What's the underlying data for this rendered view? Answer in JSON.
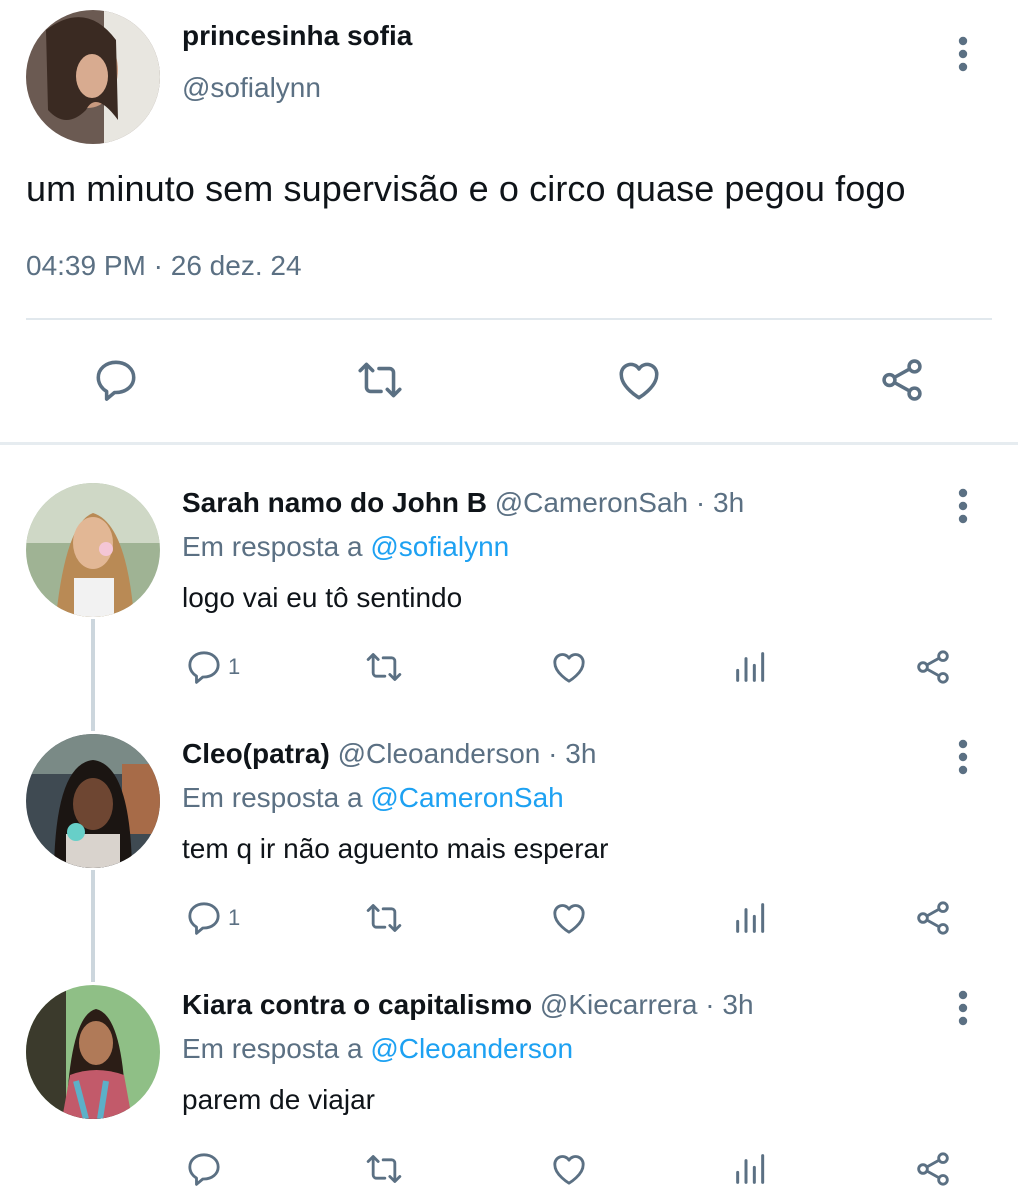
{
  "main_tweet": {
    "display_name": "princesinha sofia",
    "handle": "@sofialynn",
    "text": "um minuto sem supervisão e o circo quase pegou fogo",
    "time": "04:39 PM",
    "separator": "·",
    "date": "26 dez. 24",
    "actions": [
      "reply-icon",
      "retweet-icon",
      "like-icon",
      "share-icon"
    ]
  },
  "replies": [
    {
      "display_name": "Sarah namo do John B",
      "handle": "@CameronSah",
      "separator": "·",
      "time": "3h",
      "reply_prefix": "Em resposta a ",
      "reply_to": "@sofialynn",
      "text": "logo vai eu tô sentindo",
      "reply_count": "1"
    },
    {
      "display_name": "Cleo(patra)",
      "handle": "@Cleoanderson",
      "separator": "·",
      "time": "3h",
      "reply_prefix": "Em resposta a ",
      "reply_to": "@CameronSah",
      "text": "tem q ir não aguento mais esperar",
      "reply_count": "1"
    },
    {
      "display_name": "Kiara contra o capitalismo",
      "handle": "@Kiecarrera",
      "separator": "·",
      "time": "3h",
      "reply_prefix": "Em resposta a ",
      "reply_to": "@Cleoanderson",
      "text": "parem de viajar",
      "reply_count": ""
    }
  ],
  "colors": {
    "text_primary": "#0f1419",
    "text_secondary": "#5b7083",
    "link": "#1da1f2",
    "divider": "#e1e8ed",
    "icon": "#5b7083"
  }
}
